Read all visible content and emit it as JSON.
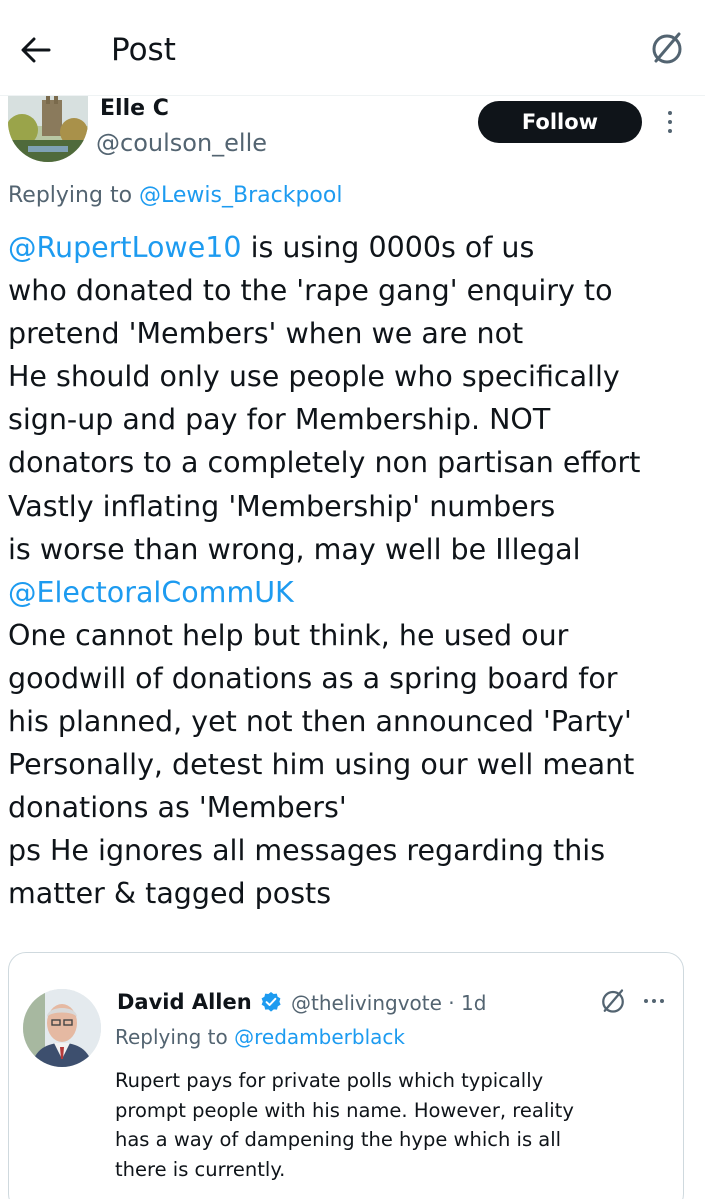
{
  "header": {
    "title": "Post"
  },
  "author": {
    "name": "Elle C",
    "handle": "@coulson_elle",
    "follow_label": "Follow"
  },
  "reply_context": {
    "prefix": "Replying to ",
    "handle": "@Lewis_Brackpool"
  },
  "tweet": {
    "mention_1": "@RupertLowe10",
    "line_1_rest": " is using 0000s of us",
    "lines_a": [
      "who donated to the 'rape gang' enquiry to",
      "pretend 'Members' when we are not",
      "He should only use people who specifically",
      "sign-up and pay for Membership. NOT",
      "donators to a completely non partisan effort",
      "Vastly inflating 'Membership' numbers",
      "is worse than wrong, may well be Illegal"
    ],
    "mention_2": "@ElectoralCommUK",
    "lines_b": [
      "One cannot help but think, he used our",
      "goodwill of donations as a spring board for",
      "his planned, yet not then announced 'Party'",
      "Personally, detest him using our well meant",
      "donations as 'Members'",
      "ps He ignores all messages regarding this",
      "matter & tagged posts"
    ]
  },
  "quoted_post": {
    "name": "David Allen",
    "handle_time": "@thelivingvote · 1d",
    "reply_prefix": "Replying to ",
    "reply_handle": "@redamberblack",
    "text_lines": [
      "Rupert pays for private polls which typically",
      "prompt people with his name. However, reality",
      "has a way of dampening the hype which is all",
      "there is currently."
    ]
  },
  "colors": {
    "link": "#1d9bf0",
    "secondary_text": "#536471",
    "primary_text": "#0f1419",
    "follow_button": "#0f1419",
    "verified_badge": "#1d9bf0"
  },
  "icons": {
    "back": "back-arrow-icon",
    "grok": "grok-icon",
    "more": "more-vertical-icon",
    "verified": "verified-badge-icon",
    "more_horizontal": "more-horizontal-icon"
  }
}
